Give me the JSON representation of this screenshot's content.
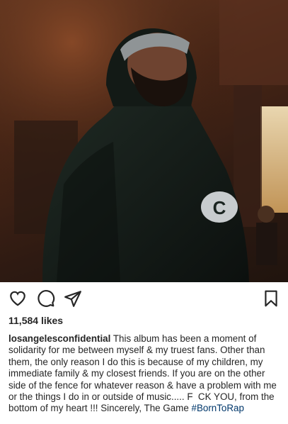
{
  "post": {
    "likes": "11,584 likes",
    "username": "losangelesconfidential",
    "caption": " This album has been a moment of solidarity for me between myself & my truest fans. Other than them, the only reason I do this is because of my children, my immediate family & my closest friends. If you are on the other side of the fence for whatever reason & have a problem with me or the things I do in or outside of music..... F  CK YOU, from the bottom of my heart !!! Sincerely, The Game ",
    "hashtag": "#BornToRap"
  },
  "image": {
    "hoodie_logo": "C"
  },
  "icons": {
    "like": "heart-icon",
    "comment": "comment-icon",
    "share": "share-icon",
    "save": "bookmark-icon"
  },
  "colors": {
    "text": "#262626",
    "hashtag": "#00376b",
    "icon": "#262626"
  }
}
